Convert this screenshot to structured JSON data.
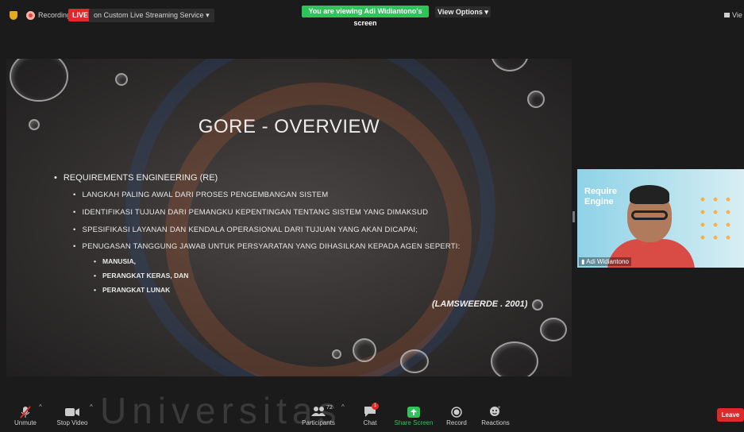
{
  "topbar": {
    "recording_label": "Recording",
    "live_badge": "LIVE",
    "stream_label": "on Custom Live Streaming Service",
    "viewing_banner": "You are viewing Adi Widiantono's screen",
    "view_options": "View Options",
    "view_label": "Vie"
  },
  "slide": {
    "title": "GORE - OVERVIEW",
    "bullet_main": "REQUIREMENTS ENGINEERING (RE)",
    "sub_bullets": [
      "LANGKAH PALING AWAL DARI PROSES PENGEMBANGAN SISTEM",
      "IDENTIFIKASI TUJUAN DARI PEMANGKU KEPENTINGAN TENTANG SISTEM YANG DIMAKSUD",
      "SPESIFIKASI LAYANAN DAN KENDALA OPERASIONAL DARI TUJUAN YANG AKAN DICAPAI;",
      "PENUGASAN TANGGUNG JAWAB UNTUK PERSYARATAN YANG DIHASILKAN KEPADA AGEN SEPERTI:"
    ],
    "sub_sub_bullets": [
      "MANUSIA,",
      "PERANGKAT KERAS, DAN",
      "PERANGKAT LUNAK"
    ],
    "citation": "(LAMSWEERDE . 2001)"
  },
  "video": {
    "background_text_line1": "Require",
    "background_text_line2": "Engine",
    "participant_name": "Adi Widiantono"
  },
  "toolbar": {
    "unmute": "Unmute",
    "stop_video": "Stop Video",
    "participants": "Participants",
    "participants_count": "72",
    "chat": "Chat",
    "chat_badge": "1",
    "share_screen": "Share Screen",
    "record": "Record",
    "reactions": "Reactions",
    "leave": "Leave",
    "watermark": "Universitas"
  },
  "colors": {
    "live_red": "#e02828",
    "share_green": "#2bc55a",
    "background": "#1b1b1b"
  }
}
